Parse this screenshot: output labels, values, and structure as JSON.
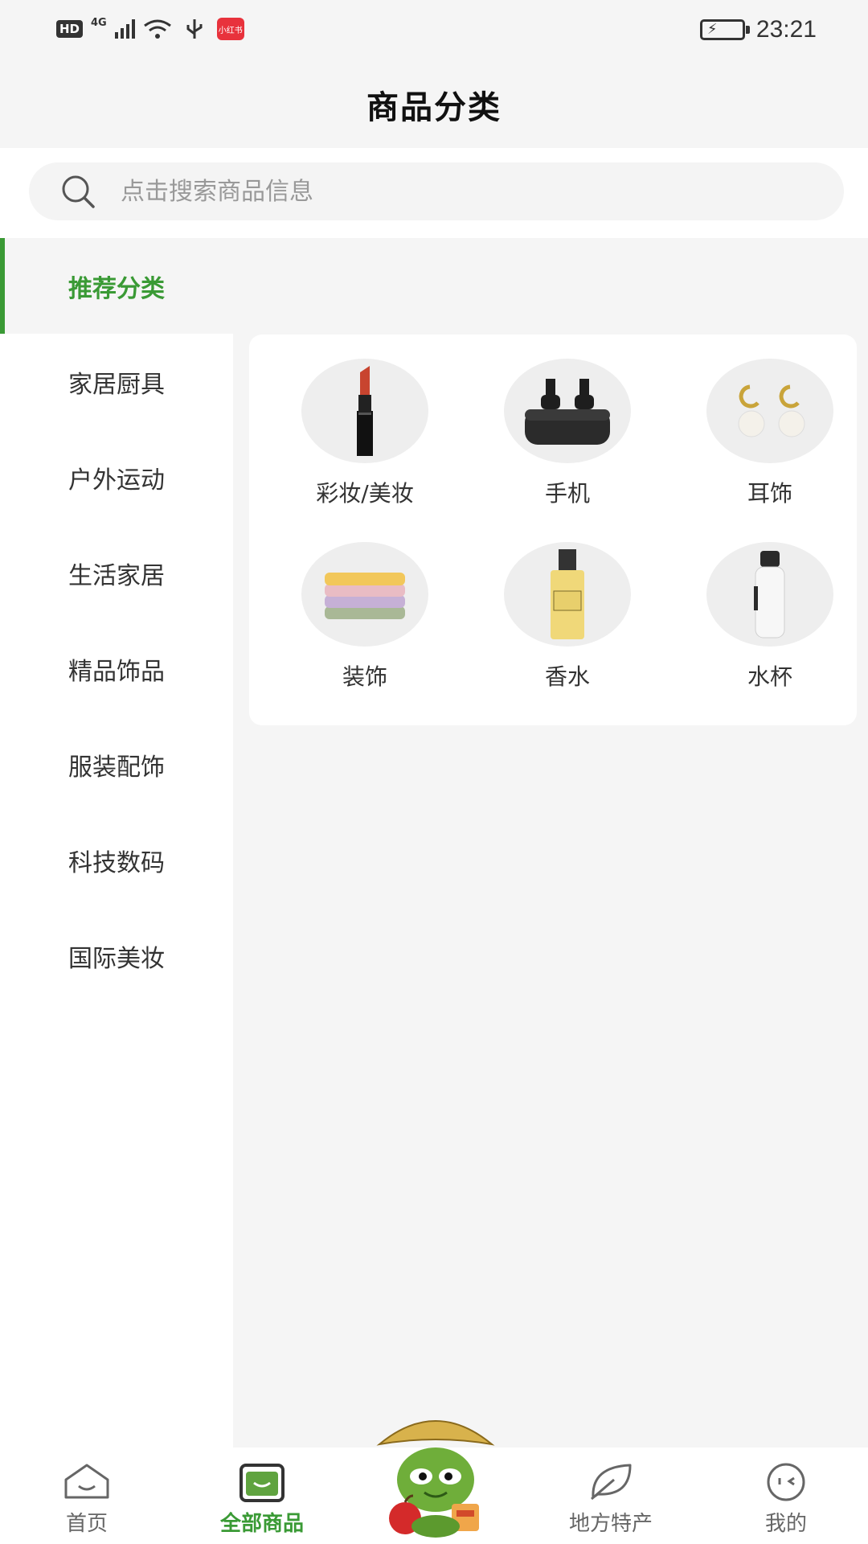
{
  "status_bar": {
    "hd": "HD",
    "network": "4G",
    "app_badge": "小红书",
    "time": "23:21"
  },
  "header": {
    "title": "商品分类"
  },
  "search": {
    "placeholder": "点击搜索商品信息"
  },
  "sidebar": {
    "items": [
      {
        "label": "推荐分类",
        "active": true
      },
      {
        "label": "家居厨具"
      },
      {
        "label": "户外运动"
      },
      {
        "label": "生活家居"
      },
      {
        "label": "精品饰品"
      },
      {
        "label": "服装配饰"
      },
      {
        "label": "科技数码"
      },
      {
        "label": "国际美妆"
      }
    ]
  },
  "categories": [
    {
      "label": "彩妆/美妆",
      "icon": "lipstick-icon"
    },
    {
      "label": "手机",
      "icon": "earbuds-icon"
    },
    {
      "label": "耳饰",
      "icon": "pearl-earrings-icon"
    },
    {
      "label": "装饰",
      "icon": "towel-stack-icon"
    },
    {
      "label": "香水",
      "icon": "perfume-bottle-icon"
    },
    {
      "label": "水杯",
      "icon": "water-bottle-icon"
    }
  ],
  "bottom_nav": [
    {
      "label": "首页",
      "icon": "home-icon"
    },
    {
      "label": "全部商品",
      "icon": "shopping-bag-icon",
      "active": true
    },
    {
      "label": "",
      "icon": "mascot-icon"
    },
    {
      "label": "地方特产",
      "icon": "leaf-icon"
    },
    {
      "label": "我的",
      "icon": "face-icon"
    }
  ],
  "colors": {
    "accent": "#3a9a35",
    "background": "#f5f5f5"
  }
}
